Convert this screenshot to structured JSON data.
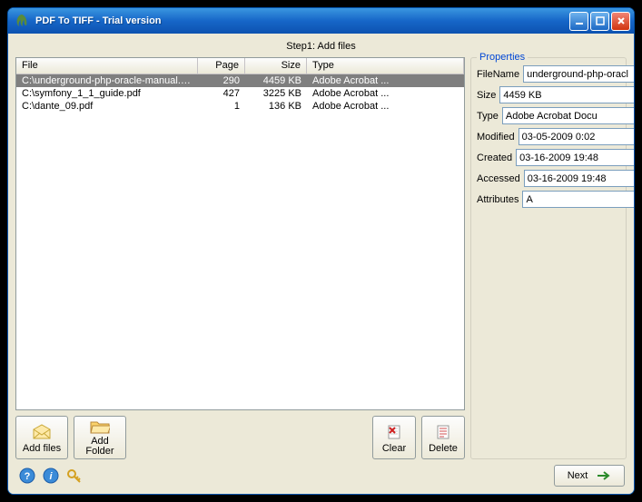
{
  "window": {
    "title": "PDF To TIFF - Trial version"
  },
  "step_label": "Step1: Add files",
  "columns": {
    "file": "File",
    "page": "Page",
    "size": "Size",
    "type": "Type"
  },
  "files": [
    {
      "file": "C:\\underground-php-oracle-manual.pdf",
      "page": "290",
      "size": "4459 KB",
      "type": "Adobe Acrobat ..."
    },
    {
      "file": "C:\\symfony_1_1_guide.pdf",
      "page": "427",
      "size": "3225 KB",
      "type": "Adobe Acrobat ..."
    },
    {
      "file": "C:\\dante_09.pdf",
      "page": "1",
      "size": "136 KB",
      "type": "Adobe Acrobat ..."
    }
  ],
  "buttons": {
    "add_files": "Add files",
    "add_folder": "Add Folder",
    "clear": "Clear",
    "delete": "Delete",
    "next": "Next"
  },
  "properties": {
    "legend": "Properties",
    "labels": {
      "filename": "FileName",
      "size": "Size",
      "type": "Type",
      "modified": "Modified",
      "created": "Created",
      "accessed": "Accessed",
      "attributes": "Attributes"
    },
    "values": {
      "filename": "underground-php-oracl",
      "size": "4459 KB",
      "type": "Adobe Acrobat Docu",
      "modified": "03-05-2009 0:02",
      "created": "03-16-2009 19:48",
      "accessed": "03-16-2009 19:48",
      "attributes": "A"
    }
  }
}
